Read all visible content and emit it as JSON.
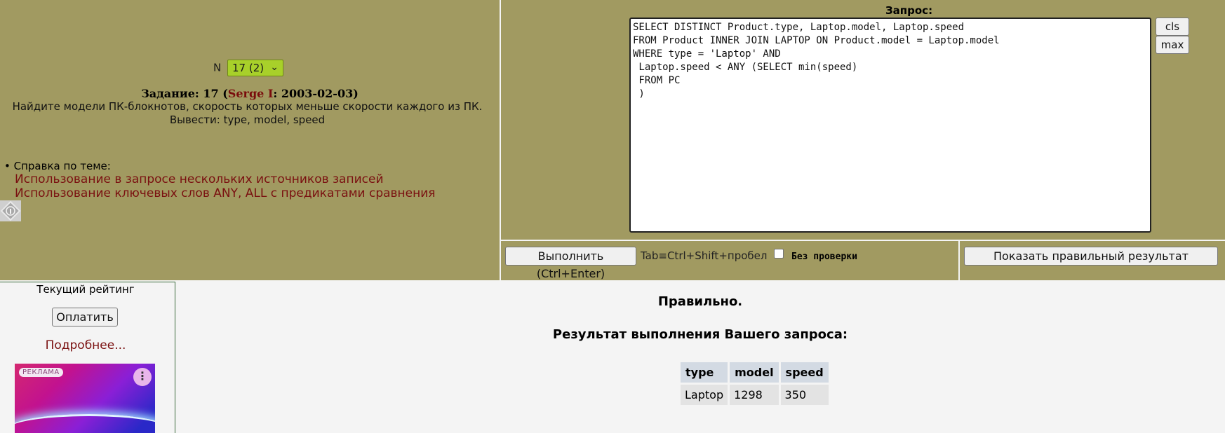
{
  "task": {
    "n_label": "N",
    "n_selected": "17 (2)",
    "title_prefix": "Задание: 17 (",
    "author": "Serge I",
    "title_suffix": ": 2003-02-03)",
    "description_line1": "Найдите модели ПК-блокнотов, скорость которых меньше скорости каждого из ПК.",
    "description_line2": "Вывести: type, model, speed"
  },
  "help": {
    "heading": "• Справка по теме:",
    "links": [
      "Использование в запросе нескольких источников записей",
      "Использование ключевых слов ANY, ALL с предикатами сравнения"
    ]
  },
  "query": {
    "label": "Запрос:",
    "text": "SELECT DISTINCT Product.type, Laptop.model, Laptop.speed\nFROM Product INNER JOIN LAPTOP ON Product.model = Laptop.model\nWHERE type = 'Laptop' AND\n Laptop.speed < ANY (SELECT min(speed)\n FROM PC\n )",
    "cls_label": "cls",
    "max_label": "max"
  },
  "controls": {
    "run_label": "Выполнить (Ctrl+Enter)",
    "tab_hint": "Tab≡Ctrl+Shift+пробел",
    "nocheck_label": "Без проверки",
    "nocheck_checked": false,
    "show_result_label": "Показать правильный результат"
  },
  "sidebar": {
    "rating_label": "Текущий рейтинг",
    "pay_label": "Оплатить",
    "more_label": "Подробнее...",
    "ad_badge": "РЕКЛАМА",
    "ad_menu_glyph": "⋮"
  },
  "result": {
    "status": "Правильно.",
    "title": "Результат выполнения Вашего запроса:",
    "columns": [
      "type",
      "model",
      "speed"
    ],
    "rows": [
      [
        "Laptop",
        "1298",
        "350"
      ]
    ]
  },
  "colors": {
    "panel": "#a19a61",
    "link": "#7a1010",
    "select_bg": "#a8d02a"
  }
}
